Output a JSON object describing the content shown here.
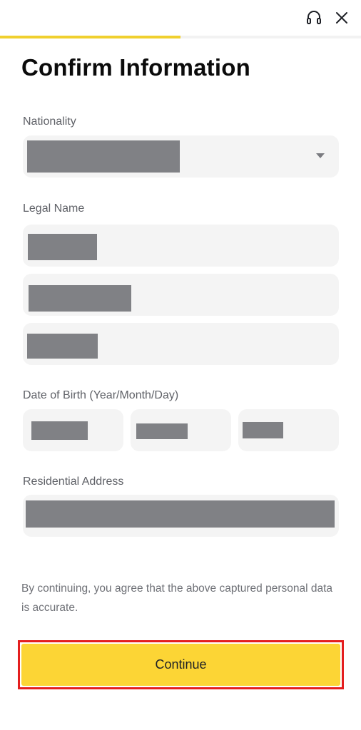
{
  "header": {
    "support_icon": "headset-icon",
    "close_icon": "close-icon",
    "progress_fraction": 0.5
  },
  "title": "Confirm Information",
  "nationality": {
    "label": "Nationality",
    "value": "[redacted]",
    "dropdown_icon": "caret-down-icon"
  },
  "legal_name": {
    "label": "Legal Name",
    "fields": [
      "[redacted]",
      "[redacted]",
      "[redacted]"
    ]
  },
  "dob": {
    "label": "Date of Birth (Year/Month/Day)",
    "year": "[redacted]",
    "month": "[redacted]",
    "day": "[redacted]"
  },
  "address": {
    "label": "Residential Address",
    "value": "[redacted]"
  },
  "consent_text": "By continuing, you agree that the above captured personal data is accurate.",
  "continue_label": "Continue",
  "colors": {
    "accent": "#fcd535",
    "progress": "#f0d02e",
    "highlight_border": "#e41e1e"
  }
}
